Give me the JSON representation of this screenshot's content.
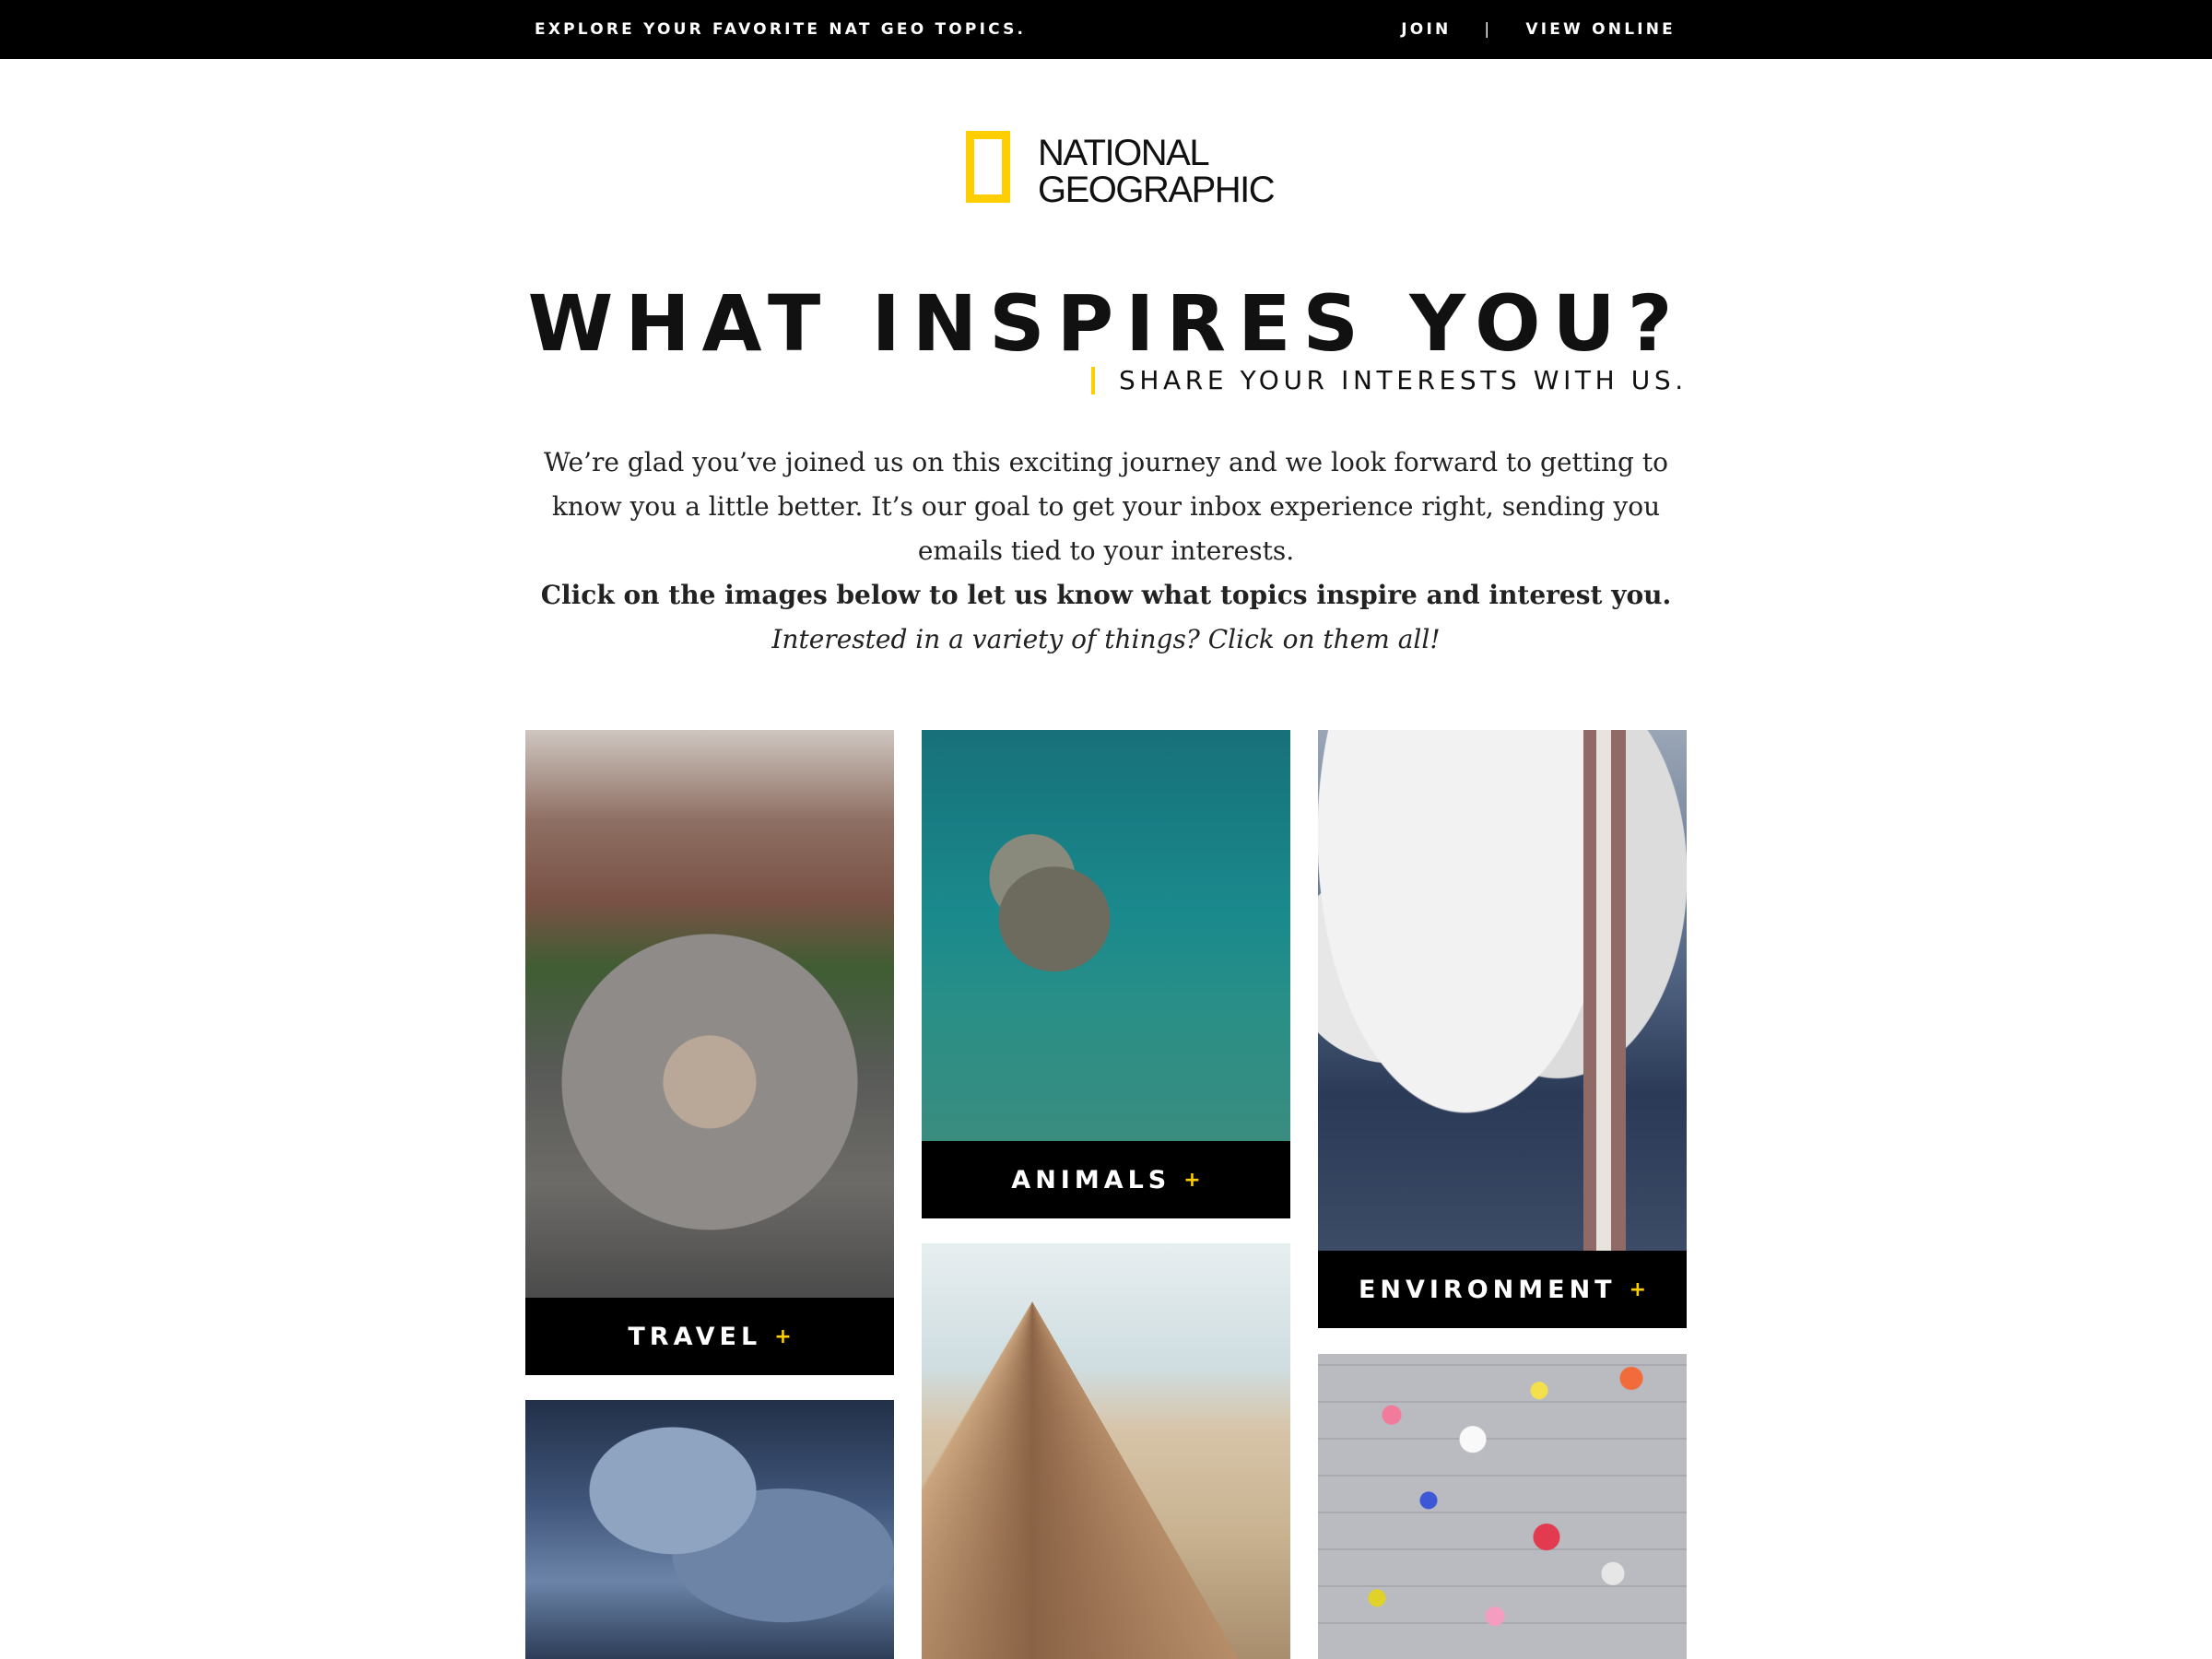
{
  "topbar": {
    "tagline": "EXPLORE YOUR FAVORITE NAT GEO TOPICS.",
    "join": "JOIN",
    "separator": "|",
    "view_online": "VIEW ONLINE"
  },
  "logo": {
    "line1": "NATIONAL",
    "line2": "GEOGRAPHIC",
    "frame_color": "#ffce00"
  },
  "headline": "WHAT INSPIRES YOU?",
  "subhead": "SHARE YOUR INTERESTS WITH US.",
  "intro": {
    "paragraph": "We’re glad you’ve joined us on this exciting journey and we look forward to getting to know you a little better. It’s our goal to get your inbox experience right, sending you emails tied to your interests.",
    "cta": "Click on the images below to let us know what topics inspire and interest you.",
    "note": "Interested in a variety of things? Click on them all!"
  },
  "tiles": [
    {
      "label": "TRAVEL",
      "plus": "+"
    },
    {
      "label": "ANIMALS",
      "plus": "+"
    },
    {
      "label": "ENVIRONMENT",
      "plus": "+"
    }
  ],
  "colors": {
    "accent": "#ffce00",
    "label_bg": "#000000",
    "label_text": "#ffffff"
  }
}
